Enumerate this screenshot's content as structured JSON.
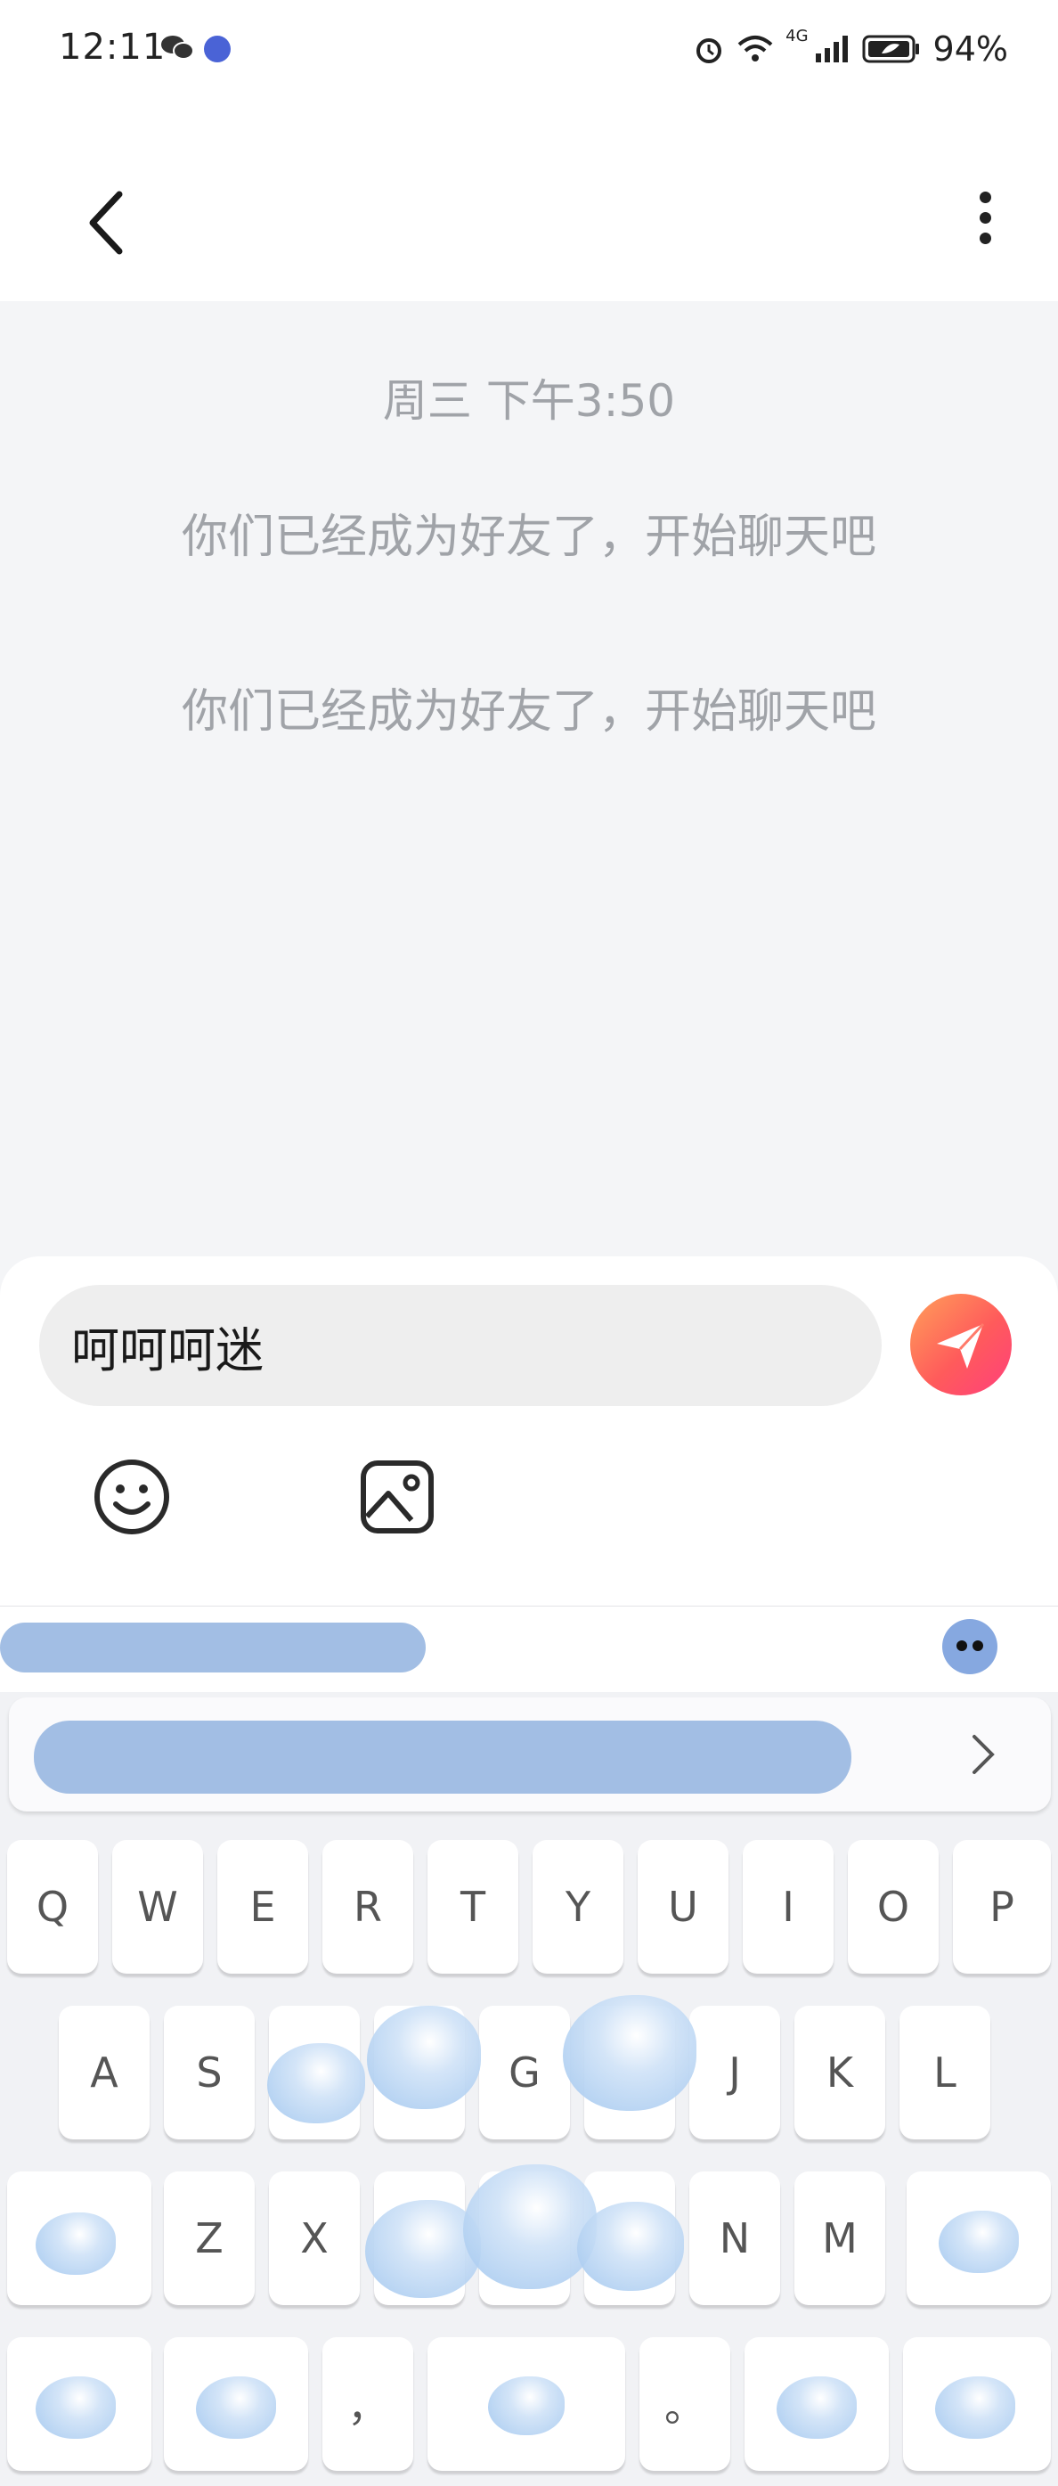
{
  "status_bar": {
    "time": "12:11",
    "network": "4G",
    "battery": "94%"
  },
  "header": {
    "back_icon": "chevron-left-icon",
    "more_icon": "vertical-dots-icon"
  },
  "chat": {
    "timestamp": "周三 下午3:50",
    "system_messages": [
      "你们已经成为好友了，开始聊天吧",
      "你们已经成为好友了，开始聊天吧"
    ]
  },
  "composer": {
    "input_value": "呵呵呵迷",
    "send_icon": "paper-plane-icon",
    "emoji_icon": "smiley-icon",
    "image_icon": "image-icon",
    "send_gradient": [
      "#ffa05a",
      "#ff3f7c"
    ]
  },
  "keyboard": {
    "row1": [
      "Q",
      "W",
      "E",
      "R",
      "T",
      "Y",
      "U",
      "I",
      "O",
      "P"
    ],
    "row2": [
      "A",
      "S",
      "",
      "",
      "G",
      "",
      "J",
      "K",
      "L"
    ],
    "row3": [
      "",
      "Z",
      "X",
      "",
      "",
      "",
      "N",
      "M",
      ""
    ],
    "row4": [
      "",
      "",
      "，",
      "",
      "。",
      "",
      ""
    ],
    "expand_icon": "chevron-right-icon",
    "mascot_icon": "koala-icon"
  }
}
